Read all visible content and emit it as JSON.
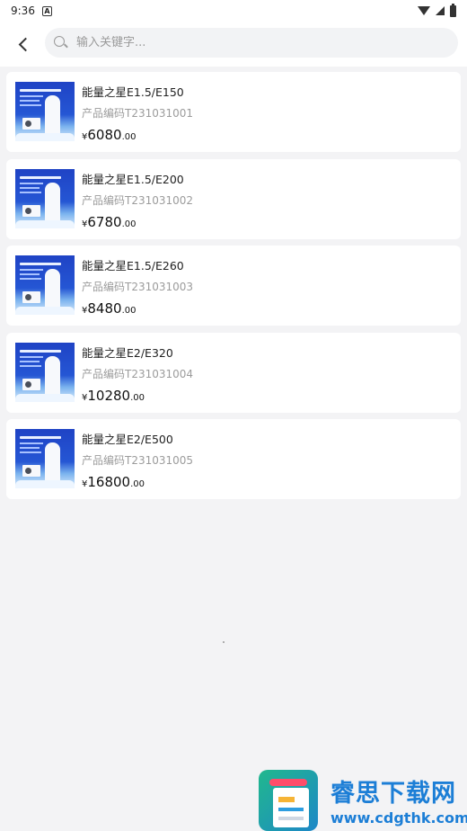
{
  "status_bar": {
    "time": "9:36",
    "notification_badge": "A"
  },
  "search": {
    "placeholder": "输入关键字..."
  },
  "products": [
    {
      "name": "能量之星E1.5/E150",
      "code": "产品编码T231031001",
      "currency": "¥",
      "price_int": "6080",
      "price_dec": ".00"
    },
    {
      "name": "能量之星E1.5/E200",
      "code": "产品编码T231031002",
      "currency": "¥",
      "price_int": "6780",
      "price_dec": ".00"
    },
    {
      "name": "能量之星E1.5/E260",
      "code": "产品编码T231031003",
      "currency": "¥",
      "price_int": "8480",
      "price_dec": ".00"
    },
    {
      "name": "能量之星E2/E320",
      "code": "产品编码T231031004",
      "currency": "¥",
      "price_int": "10280",
      "price_dec": ".00"
    },
    {
      "name": "能量之星E2/E500",
      "code": "产品编码T231031005",
      "currency": "¥",
      "price_int": "16800",
      "price_dec": ".00"
    }
  ],
  "watermark": {
    "title": "睿思下载网",
    "url": "www.cdgthk.com"
  },
  "colors": {
    "price": "#111111",
    "secondary_text": "#9c9c9c",
    "page_bg": "#f3f3f5",
    "watermark": "#1c7ed6"
  },
  "icons": [
    "back-chevron-icon",
    "search-icon",
    "wifi-icon",
    "signal-icon",
    "battery-icon"
  ]
}
